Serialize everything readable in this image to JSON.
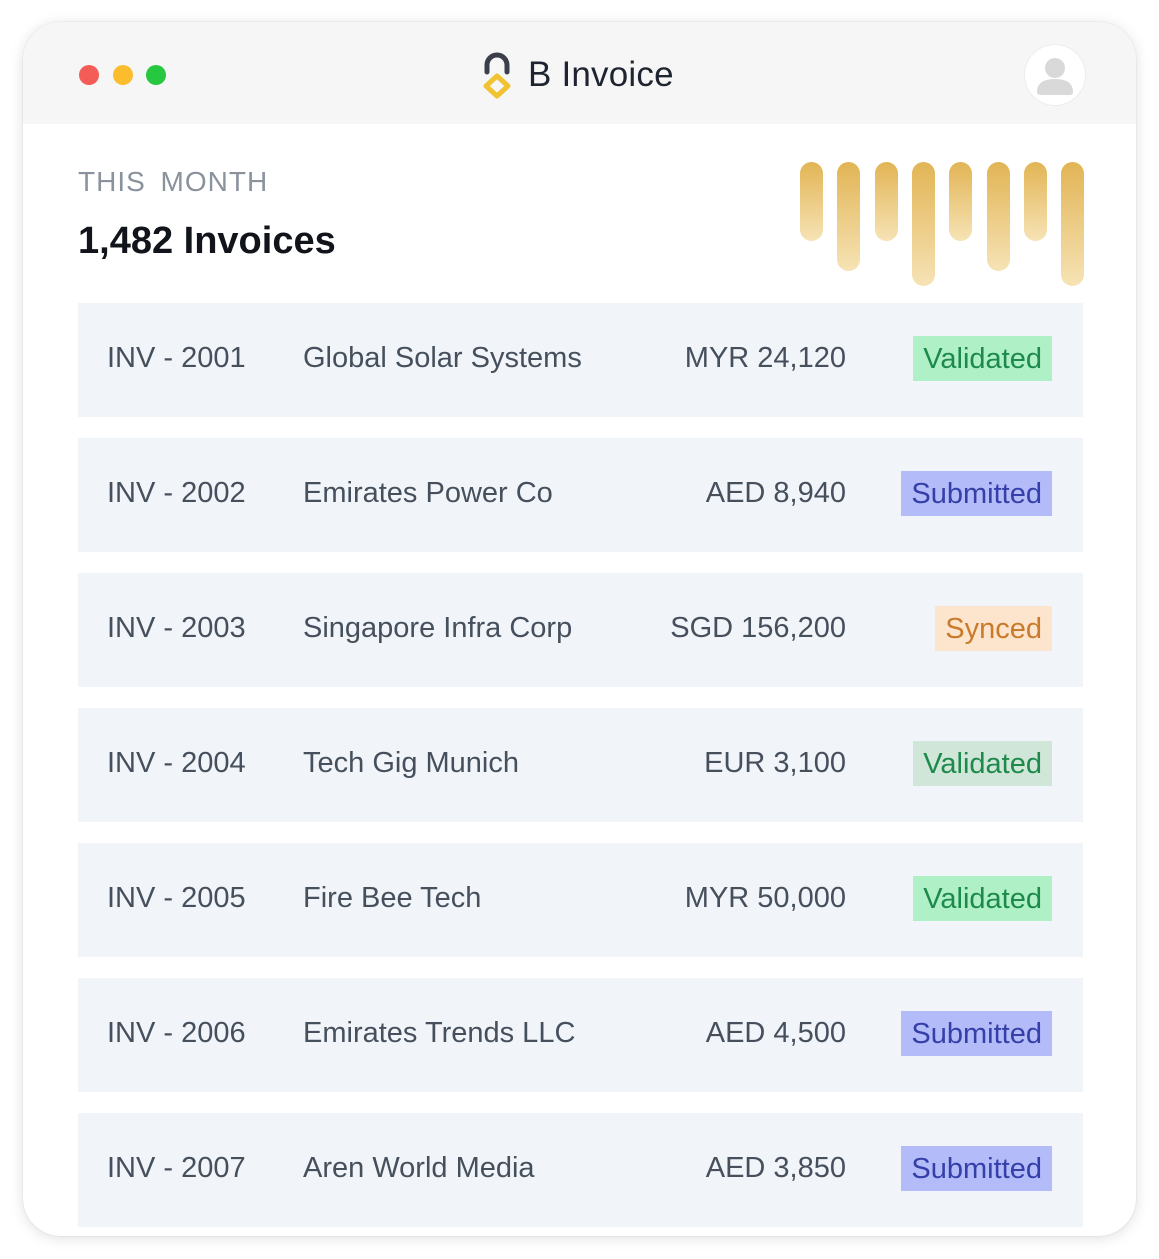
{
  "app": {
    "title": "B Invoice",
    "brand_colors": {
      "logo_dark": "#3a3f4b",
      "logo_gold": "#f1c232"
    }
  },
  "window_controls": [
    "close",
    "minimize",
    "maximize"
  ],
  "header": {
    "avatar_icon": "user-avatar-icon"
  },
  "summary": {
    "period_label": "THIS  MONTH",
    "count_label": "1,482 Invoices"
  },
  "sparkline": {
    "type": "bar",
    "note_colors": [
      "#e2b455",
      "#f6e3b5"
    ],
    "values": [
      0.64,
      0.88,
      0.64,
      1.0,
      0.64,
      0.88,
      0.64,
      1.0
    ]
  },
  "status_colors": {
    "Validated": {
      "bg": "#aff0c7",
      "fg": "#1d8a4c"
    },
    "Validated-alt": {
      "bg": "#cfe6d8",
      "fg": "#1d8a4c"
    },
    "Submitted": {
      "bg": "#b4bbf9",
      "fg": "#343fa8"
    },
    "Synced": {
      "bg": "#fde4cc",
      "fg": "#c97b2c"
    }
  },
  "invoices": [
    {
      "id": "INV - 2001",
      "customer": "Global Solar Systems",
      "amount": "MYR 24,120",
      "status": "Validated",
      "style": "Validated"
    },
    {
      "id": "INV - 2002",
      "customer": "Emirates Power Co",
      "amount": "AED 8,940",
      "status": "Submitted",
      "style": "Submitted"
    },
    {
      "id": "INV - 2003",
      "customer": "Singapore Infra Corp",
      "amount": "SGD 156,200",
      "status": "Synced",
      "style": "Synced"
    },
    {
      "id": "INV - 2004",
      "customer": "Tech Gig Munich",
      "amount": "EUR 3,100",
      "status": "Validated",
      "style": "Validated-alt"
    },
    {
      "id": "INV - 2005",
      "customer": "Fire Bee Tech",
      "amount": "MYR 50,000",
      "status": "Validated",
      "style": "Validated"
    },
    {
      "id": "INV - 2006",
      "customer": "Emirates Trends LLC",
      "amount": "AED 4,500",
      "status": "Submitted",
      "style": "Submitted"
    },
    {
      "id": "INV - 2007",
      "customer": "Aren World Media",
      "amount": "AED 3,850",
      "status": "Submitted",
      "style": "Submitted"
    }
  ]
}
